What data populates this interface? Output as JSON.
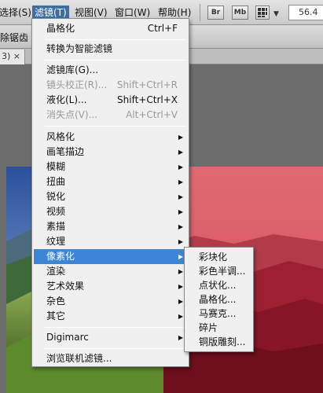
{
  "menubar": {
    "items": [
      {
        "label": "选择(S)",
        "active": false
      },
      {
        "label": "滤镜(T)",
        "active": true
      },
      {
        "label": "视图(V)",
        "active": false
      },
      {
        "label": "窗口(W)",
        "active": false
      },
      {
        "label": "帮助(H)",
        "active": false
      }
    ],
    "bridge_button": "Br",
    "minibridge_button": "Mb",
    "zoom_value": "56.4"
  },
  "options_bar": {
    "remove_aliasing_label": "除锯齿"
  },
  "document_tab": {
    "label": "3) ×"
  },
  "filter_menu": {
    "items": [
      {
        "label": "晶格化",
        "shortcut": "Ctrl+F"
      },
      {
        "label": "转换为智能滤镜",
        "shortcut": ""
      },
      {
        "label": "滤镜库(G)...",
        "shortcut": ""
      },
      {
        "label": "镜头校正(R)...",
        "shortcut": "Shift+Ctrl+R",
        "disabled": true
      },
      {
        "label": "液化(L)...",
        "shortcut": "Shift+Ctrl+X"
      },
      {
        "label": "消失点(V)...",
        "shortcut": "Alt+Ctrl+V",
        "disabled": true
      },
      {
        "label": "风格化",
        "submenu": true
      },
      {
        "label": "画笔描边",
        "submenu": true
      },
      {
        "label": "模糊",
        "submenu": true
      },
      {
        "label": "扭曲",
        "submenu": true
      },
      {
        "label": "锐化",
        "submenu": true
      },
      {
        "label": "视频",
        "submenu": true
      },
      {
        "label": "素描",
        "submenu": true
      },
      {
        "label": "纹理",
        "submenu": true
      },
      {
        "label": "像素化",
        "submenu": true,
        "highlighted": true
      },
      {
        "label": "渲染",
        "submenu": true
      },
      {
        "label": "艺术效果",
        "submenu": true
      },
      {
        "label": "杂色",
        "submenu": true
      },
      {
        "label": "其它",
        "submenu": true
      },
      {
        "label": "Digimarc",
        "submenu": true
      },
      {
        "label": "浏览联机滤镜...",
        "shortcut": ""
      }
    ]
  },
  "pixelate_submenu": {
    "items": [
      "彩块化",
      "彩色半调...",
      "点状化...",
      "晶格化...",
      "马赛克...",
      "碎片",
      "铜版雕刻..."
    ]
  },
  "colors": {
    "menu_highlight": "#3d84d4",
    "menubar_active": "#3a6ea5"
  }
}
